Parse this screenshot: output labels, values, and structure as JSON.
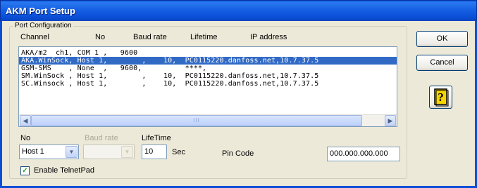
{
  "window": {
    "title": "AKM Port Setup"
  },
  "group": {
    "label": "Port Configuration"
  },
  "headers": {
    "channel": "Channel",
    "no": "No",
    "baud_rate": "Baud rate",
    "lifetime": "Lifetime",
    "ip_address": "IP address"
  },
  "list": {
    "rows": [
      {
        "text": "AKA/m2  ch1, COM 1 ,   9600",
        "selected": false
      },
      {
        "text": "AKA.WinSock, Host 1,        ,    10,  PC0115220.danfoss.net,10.7.37.5",
        "selected": true
      },
      {
        "text": "GSM-SMS    , None  ,   9600,          ****,",
        "selected": false
      },
      {
        "text": "SM.WinSock , Host 1,        ,    10,  PC0115220.danfoss.net,10.7.37.5",
        "selected": false
      },
      {
        "text": "SC.Winsock , Host 1,        ,    10,  PC0115220.danfoss.net,10.7.37.5",
        "selected": false
      }
    ]
  },
  "labels": {
    "no": "No",
    "baud_rate": "Baud rate",
    "lifetime": "LifeTime",
    "sec": "Sec",
    "pin_code": "Pin Code",
    "enable_telnetpad": "Enable TelnetPad"
  },
  "fields": {
    "no_value": "Host 1",
    "baud_value": "",
    "lifetime_value": "10",
    "pin_code_value": "000.000.000.000",
    "enable_telnetpad_checked": true
  },
  "buttons": {
    "ok": "OK",
    "cancel": "Cancel"
  },
  "scrollbar": {
    "thumb_grip": "III"
  },
  "colors": {
    "title_bar": "#0a4fd6",
    "selection": "#316ac5",
    "face": "#ece9d8"
  },
  "icons": [
    "help-icon",
    "scroll-left-icon",
    "scroll-right-icon",
    "dropdown-arrow-icon",
    "checkmark-icon"
  ]
}
